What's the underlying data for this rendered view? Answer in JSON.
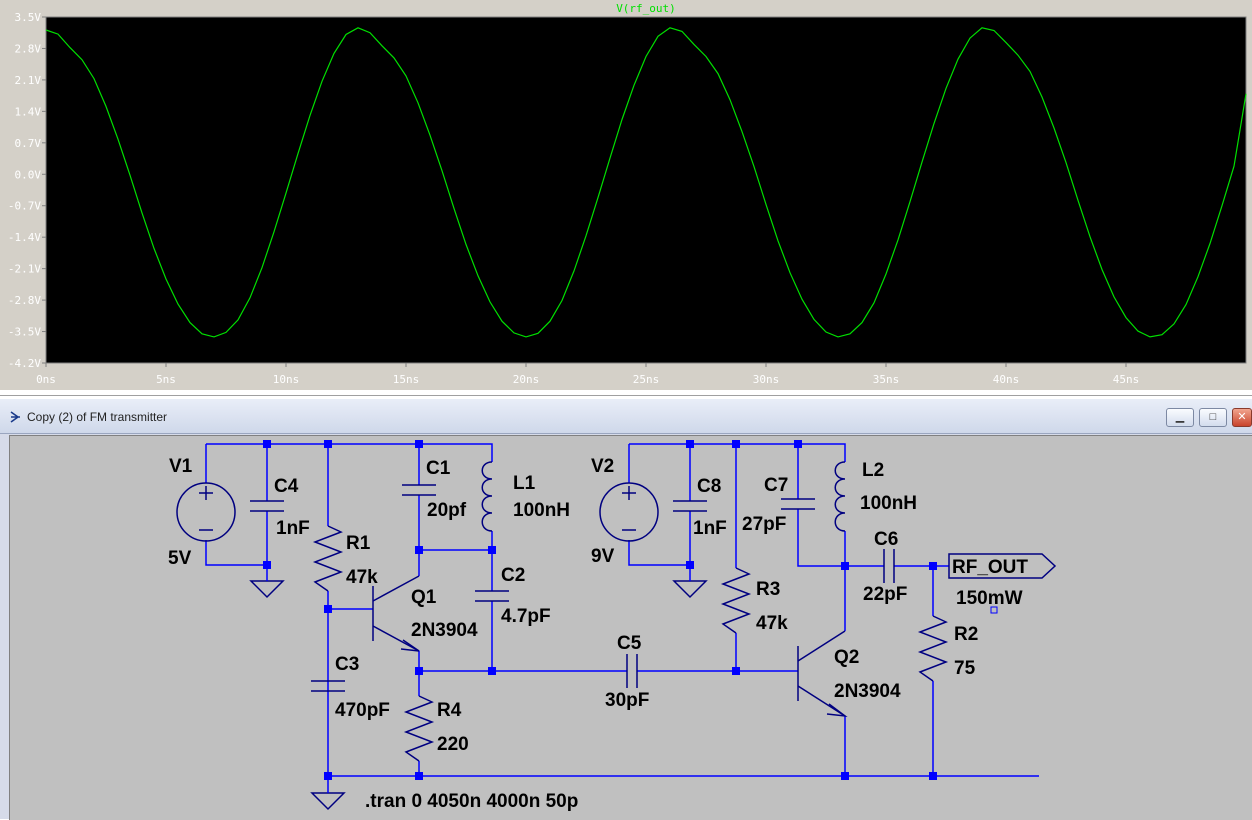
{
  "waveform_plot": {
    "trace_name": "V(rf_out)",
    "background": "#000000",
    "trace_color": "#00e000",
    "y_ticks": [
      "3.5V",
      "2.8V",
      "2.1V",
      "1.4V",
      "0.7V",
      "0.0V",
      "-0.7V",
      "-1.4V",
      "-2.1V",
      "-2.8V",
      "-3.5V",
      "-4.2V"
    ],
    "x_ticks": [
      "0ns",
      "5ns",
      "10ns",
      "15ns",
      "20ns",
      "25ns",
      "30ns",
      "35ns",
      "40ns",
      "45ns"
    ]
  },
  "chart_data": {
    "type": "line",
    "xlabel": "",
    "ylabel": "",
    "x_unit": "ns",
    "y_unit": "V",
    "xlim": [
      0,
      50
    ],
    "ylim": [
      -4.2,
      3.5
    ],
    "grid": false,
    "series": [
      {
        "name": "V(rf_out)",
        "x": [
          0,
          0.5,
          1,
          1.5,
          2,
          2.5,
          3,
          3.5,
          4,
          4.5,
          5,
          5.5,
          6,
          6.5,
          7,
          7.5,
          8,
          8.5,
          9,
          9.5,
          10,
          10.5,
          11,
          11.5,
          12,
          12.5,
          13,
          13.5,
          14,
          14.5,
          15,
          15.5,
          16,
          16.5,
          17,
          17.5,
          18,
          18.5,
          19,
          19.5,
          20,
          20.5,
          21,
          21.5,
          22,
          22.5,
          23,
          23.5,
          24,
          24.5,
          25,
          25.5,
          26,
          26.5,
          27,
          27.5,
          28,
          28.5,
          29,
          29.5,
          30,
          30.5,
          31,
          31.5,
          32,
          32.5,
          33,
          33.5,
          34,
          34.5,
          35,
          35.5,
          36,
          36.5,
          37,
          37.5,
          38,
          38.5,
          39,
          39.5,
          40,
          40.5,
          41,
          41.5,
          42,
          42.5,
          43,
          43.5,
          44,
          44.5,
          45,
          45.5,
          46,
          46.5,
          47,
          47.5,
          48,
          48.5,
          49,
          49.5,
          50
        ],
        "y": [
          3.21,
          3.12,
          2.82,
          2.55,
          2.13,
          1.51,
          0.78,
          -0.02,
          -0.86,
          -1.65,
          -2.33,
          -2.89,
          -3.3,
          -3.55,
          -3.62,
          -3.52,
          -3.24,
          -2.75,
          -2.08,
          -1.28,
          -0.42,
          0.46,
          1.31,
          2.07,
          2.69,
          3.11,
          3.26,
          3.15,
          2.86,
          2.59,
          2.19,
          1.59,
          0.87,
          0.08,
          -0.76,
          -1.56,
          -2.26,
          -2.84,
          -3.27,
          -3.53,
          -3.62,
          -3.54,
          -3.27,
          -2.81,
          -2.15,
          -1.37,
          -0.52,
          0.36,
          1.22,
          1.98,
          2.62,
          3.07,
          3.26,
          3.18,
          2.89,
          2.62,
          2.24,
          1.66,
          0.95,
          0.17,
          -0.67,
          -1.48,
          -2.19,
          -2.78,
          -3.23,
          -3.51,
          -3.62,
          -3.55,
          -3.3,
          -2.86,
          -2.22,
          -1.46,
          -0.61,
          0.27,
          1.13,
          1.91,
          2.56,
          3.03,
          3.26,
          3.2,
          2.93,
          2.65,
          2.29,
          1.72,
          1.03,
          0.26,
          -0.58,
          -1.39,
          -2.12,
          -2.73,
          -3.19,
          -3.49,
          -3.62,
          -3.57,
          -3.33,
          -2.9,
          -2.28,
          -1.54,
          -0.7,
          0.18,
          1.79
        ]
      }
    ]
  },
  "schematic_window": {
    "title": "Copy (2) of FM transmitter",
    "buttons": {
      "minimize": "▁",
      "maximize": "□",
      "close": "✕"
    },
    "background": "#c0c0c0",
    "wire_color": "#0000ff",
    "labels": {
      "V1": "V1",
      "V1_value": "5V",
      "C4": "C4",
      "C4_value": "1nF",
      "R1": "R1",
      "R1_value": "47k",
      "C1": "C1",
      "C1_value": "20pf",
      "L1": "L1",
      "L1_value": "100nH",
      "Q1": "Q1",
      "Q1_value": "2N3904",
      "C2": "C2",
      "C2_value": "4.7pF",
      "C3": "C3",
      "C3_value": "470pF",
      "R4": "R4",
      "R4_value": "220",
      "C5": "C5",
      "C5_value": "30pF",
      "V2": "V2",
      "V2_value": "9V",
      "C8": "C8",
      "C8_value": "1nF",
      "C7": "C7",
      "C7_value": "27pF",
      "L2": "L2",
      "L2_value": "100nH",
      "R3": "R3",
      "R3_value": "47k",
      "Q2": "Q2",
      "Q2_value": "2N3904",
      "C6": "C6",
      "C6_value": "22pF",
      "R2": "R2",
      "R2_value": "75",
      "rf_out_port": "RF_OUT",
      "power_annotation": "150mW",
      "tran_directive": ".tran 0 4050n 4000n 50p"
    }
  }
}
